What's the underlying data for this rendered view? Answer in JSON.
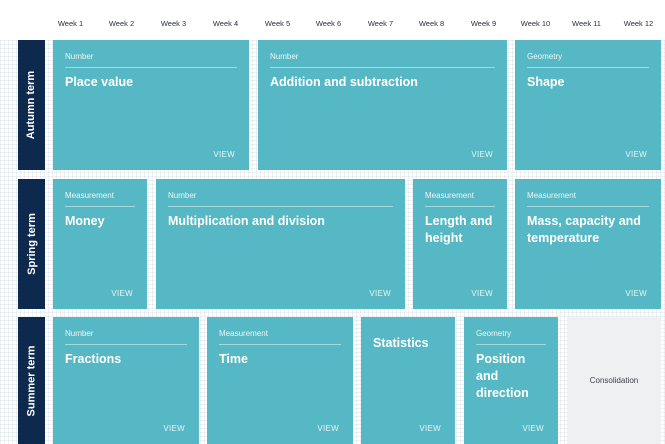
{
  "weeks": [
    "Week 1",
    "Week 2",
    "Week 3",
    "Week 4",
    "Week 5",
    "Week 6",
    "Week 7",
    "Week 8",
    "Week 9",
    "Week 10",
    "Week 11",
    "Week 12"
  ],
  "colors": {
    "block": "#56b8c4",
    "term_label_bg": "#0d2a4e",
    "consolidation_bg": "#eff0f1"
  },
  "terms": {
    "autumn": {
      "label": "Autumn term",
      "blocks": [
        {
          "strand": "Number",
          "title": "Place value",
          "view": "VIEW"
        },
        {
          "strand": "Number",
          "title": "Addition and subtraction",
          "view": "VIEW"
        },
        {
          "strand": "Geometry",
          "title": "Shape",
          "view": "VIEW"
        }
      ]
    },
    "spring": {
      "label": "Spring term",
      "blocks": [
        {
          "strand": "Measurement",
          "title": "Money",
          "view": "VIEW"
        },
        {
          "strand": "Number",
          "title": "Multiplication and division",
          "view": "VIEW"
        },
        {
          "strand": "Measurement",
          "title": "Length and height",
          "view": "VIEW"
        },
        {
          "strand": "Measurement",
          "title": "Mass, capacity and temperature",
          "view": "VIEW"
        }
      ]
    },
    "summer": {
      "label": "Summer term",
      "blocks": [
        {
          "strand": "Number",
          "title": "Fractions",
          "view": "VIEW"
        },
        {
          "strand": "Measurement",
          "title": "Time",
          "view": "VIEW"
        },
        {
          "strand": "",
          "title": "Statistics",
          "view": "VIEW"
        },
        {
          "strand": "Geometry",
          "title": "Position and direction",
          "view": "VIEW"
        }
      ],
      "consolidation": "Consolidation"
    }
  }
}
